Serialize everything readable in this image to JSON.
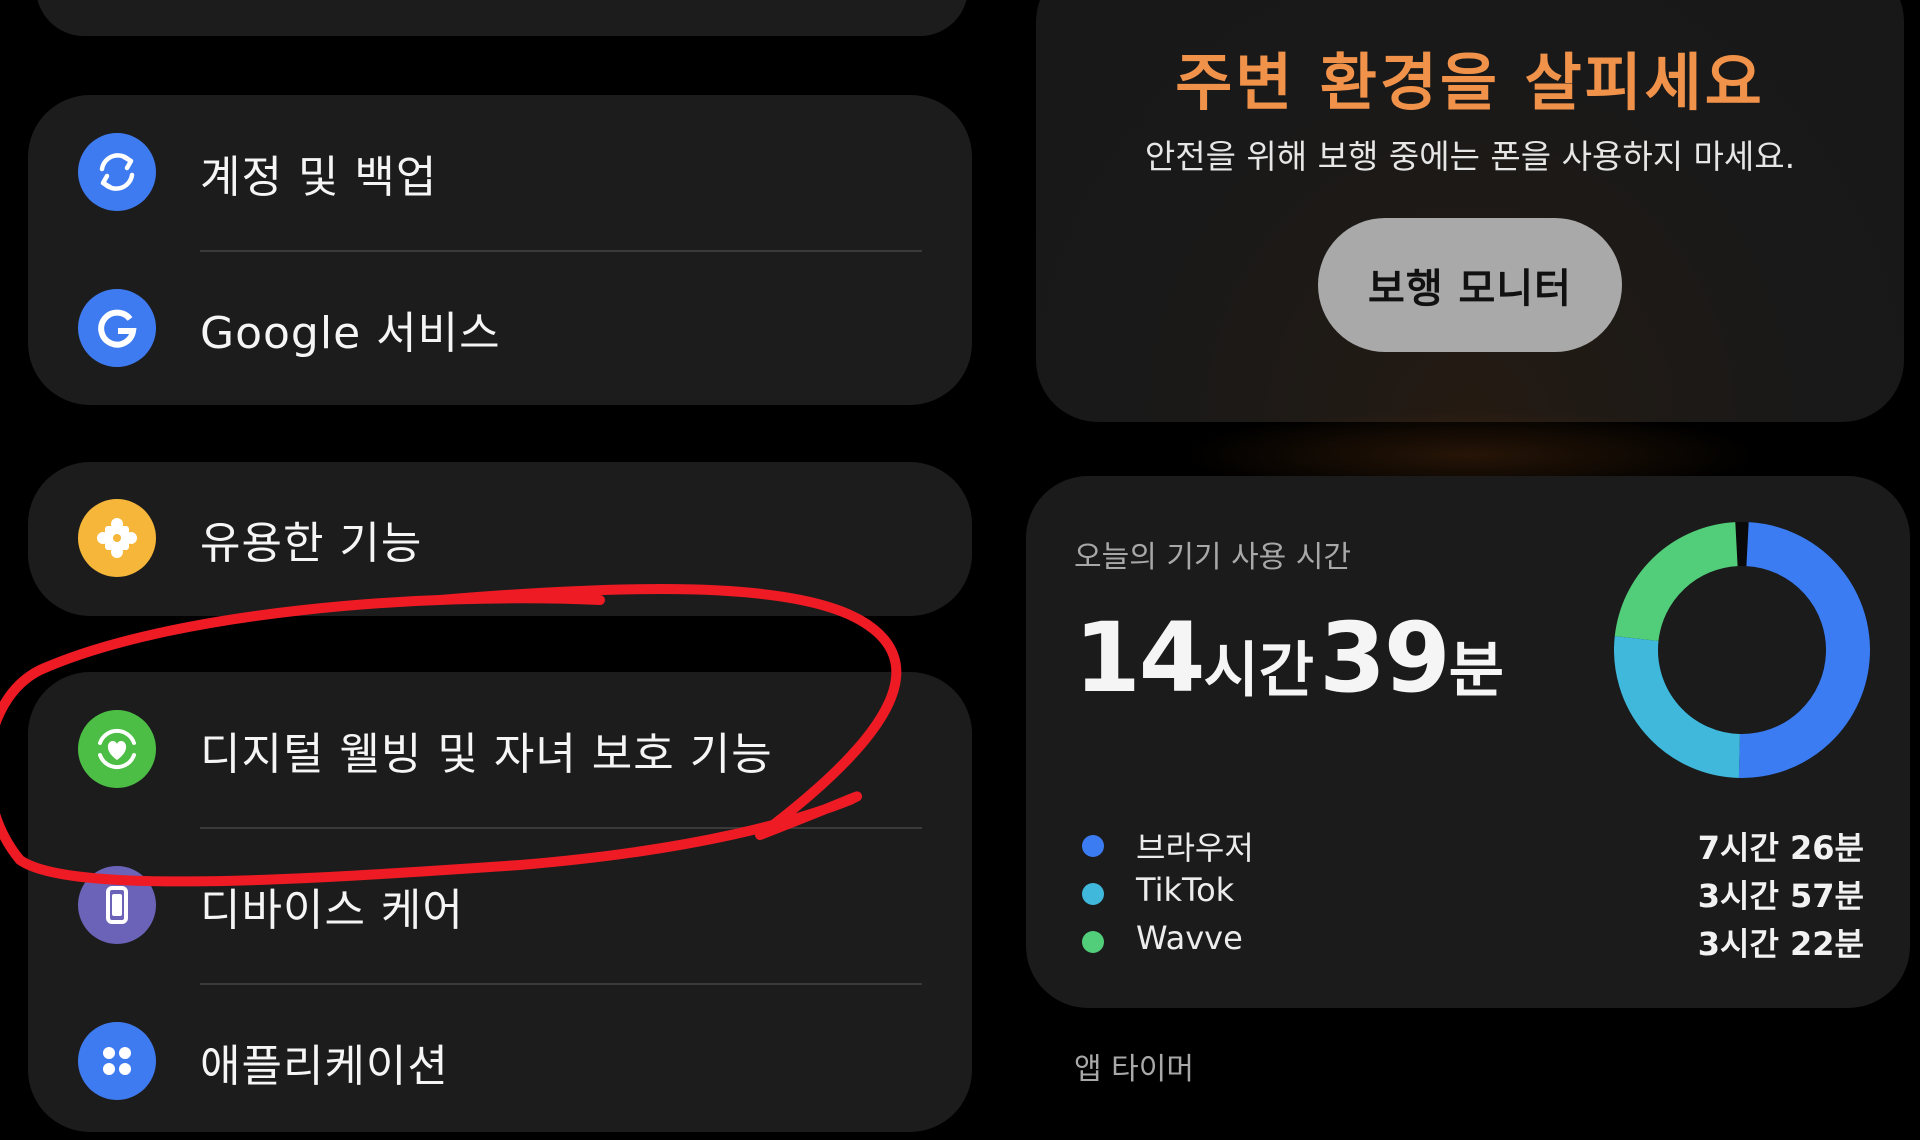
{
  "settings": {
    "items": [
      {
        "id": "accounts",
        "label": "계정 및 백업",
        "icon": "sync-icon",
        "color": "#3f7bf0"
      },
      {
        "id": "google",
        "label": "Google 서비스",
        "icon": "google-g-icon",
        "color": "#3f7bf0"
      },
      {
        "id": "useful",
        "label": "유용한 기능",
        "icon": "puzzle-icon",
        "color": "#f5b63a"
      },
      {
        "id": "digital",
        "label": "디지털 웰빙 및 자녀 보호 기능",
        "icon": "heart-circle-icon",
        "color": "#4cbd45"
      },
      {
        "id": "device",
        "label": "디바이스 케어",
        "icon": "device-care-icon",
        "color": "#6a63b8"
      },
      {
        "id": "apps",
        "label": "애플리케이션",
        "icon": "apps-grid-icon",
        "color": "#3f7bf0"
      }
    ]
  },
  "walk": {
    "title": "주변 환경을 살피세요",
    "subtitle": "안전을 위해 보행 중에는 폰을 사용하지 마세요.",
    "button": "보행 모니터",
    "title_color": "#f0924a"
  },
  "usage": {
    "label": "오늘의 기기 사용 시간",
    "total": {
      "hours": "14",
      "hours_unit": "시간",
      "minutes": "39",
      "minutes_unit": "분"
    },
    "legend": [
      {
        "name": "브라우저",
        "time": "7시간 26분",
        "color": "#3b7cf2"
      },
      {
        "name": "TikTok",
        "time": "3시간 57분",
        "color": "#40b8dc"
      },
      {
        "name": "Wavve",
        "time": "3시간 22분",
        "color": "#52cd7a"
      }
    ],
    "chart_data": {
      "type": "pie",
      "categories": [
        "브라우저",
        "TikTok",
        "Wavve"
      ],
      "values": [
        446,
        237,
        202
      ],
      "colors": [
        "#3b7cf2",
        "#40b8dc",
        "#52cd7a"
      ],
      "donut": true
    }
  },
  "app_timer": {
    "label": "앱 타이머"
  },
  "annotation": {
    "color": "#ee1b24"
  }
}
